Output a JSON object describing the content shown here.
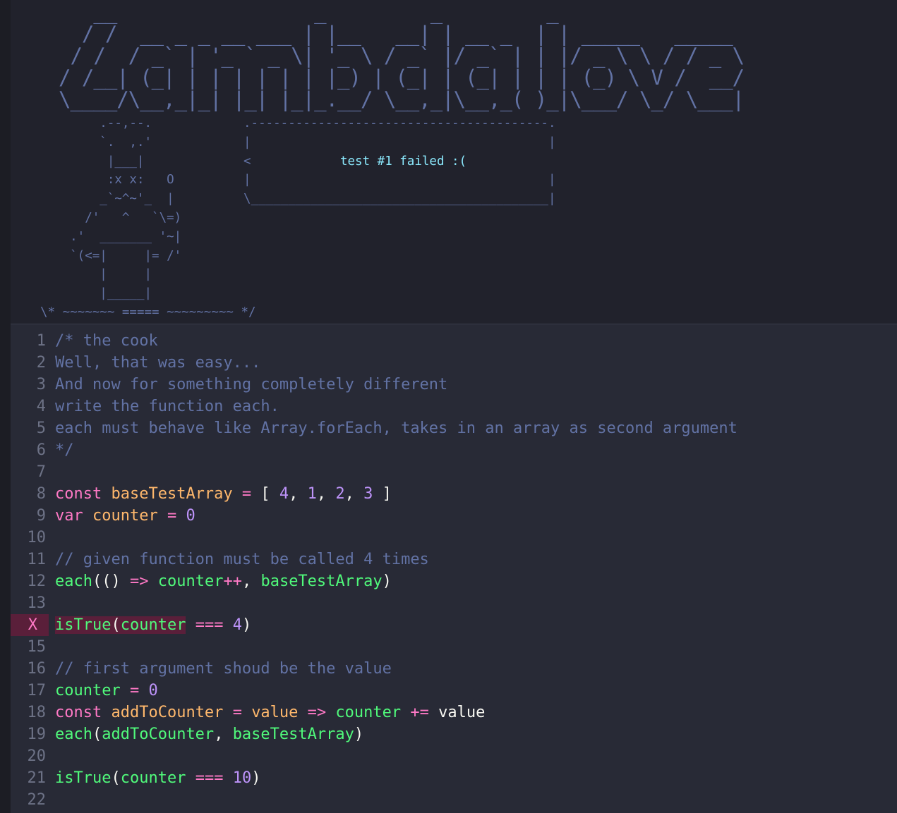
{
  "banner": {
    "logo_ascii": "   __                 _         _         _\n  / /  __ _ _ __ ___ | |__   __| | __ _  | | _____   _____\n / /  / _` | '_ ` _ \\| '_ \\ / _` |/ _` | | |/ _ \\ \\ / / _ \\\n/ /__| (_| | | | | | | |_) | (_| | (_| | | | (_) \\ V /  __/\n\\____/\\__,_|_| |_| |_|_.__/ \\__,_|\\__,_( )_|\\___/ \\_/ \\___|",
    "cook_ascii": "        .--,--.\n        `.  ,.'\n         |___|\n         :x x:   O\n        _`~^~'_  |\n      /'   ^   `\\=)\n    .'  _______ '~|\n    `(<=|     |= /'\n        |     |\n        |_____|",
    "bubble_top": ".----------------------------------------.",
    "bubble_side": "|                                        |",
    "bubble_pointer": "<",
    "bubble_message": "test #1 failed :(",
    "bubble_bottom": "\\________________________________________|",
    "footer_ascii": "\\* ~~~~~~~ ===== ~~~~~~~~~ */"
  },
  "editor": {
    "lines": [
      {
        "num": "1",
        "text": "/* the cook"
      },
      {
        "num": "2",
        "text": "Well, that was easy..."
      },
      {
        "num": "3",
        "text": "And now for something completely different"
      },
      {
        "num": "4",
        "text": "write the function each."
      },
      {
        "num": "5",
        "text": "each must behave like Array.forEach, takes in an array as second argument"
      },
      {
        "num": "6",
        "text": "*/"
      },
      {
        "num": "7",
        "text": ""
      },
      {
        "num": "8",
        "text": "const baseTestArray = [ 4, 1, 2, 3 ]"
      },
      {
        "num": "9",
        "text": "var counter = 0"
      },
      {
        "num": "10",
        "text": ""
      },
      {
        "num": "11",
        "text": "// given function must be called 4 times"
      },
      {
        "num": "12",
        "text": "each(() => counter++, baseTestArray)"
      },
      {
        "num": "13",
        "text": ""
      },
      {
        "num": "X",
        "text": "isTrue(counter === 4)",
        "error": true
      },
      {
        "num": "15",
        "text": ""
      },
      {
        "num": "16",
        "text": "// first argument shoud be the value"
      },
      {
        "num": "17",
        "text": "counter = 0"
      },
      {
        "num": "18",
        "text": "const addToCounter = value => counter += value"
      },
      {
        "num": "19",
        "text": "each(addToCounter, baseTestArray)"
      },
      {
        "num": "20",
        "text": ""
      },
      {
        "num": "21",
        "text": "isTrue(counter === 10)"
      },
      {
        "num": "22",
        "text": ""
      }
    ]
  },
  "colors": {
    "background": "#282a36",
    "banner_background": "#21222c",
    "comment": "#6272a4",
    "keyword": "#ff79c6",
    "variable": "#ffb86c",
    "number": "#bd93f9",
    "function": "#50fa7b",
    "error_highlight": "#5a1f3a"
  }
}
